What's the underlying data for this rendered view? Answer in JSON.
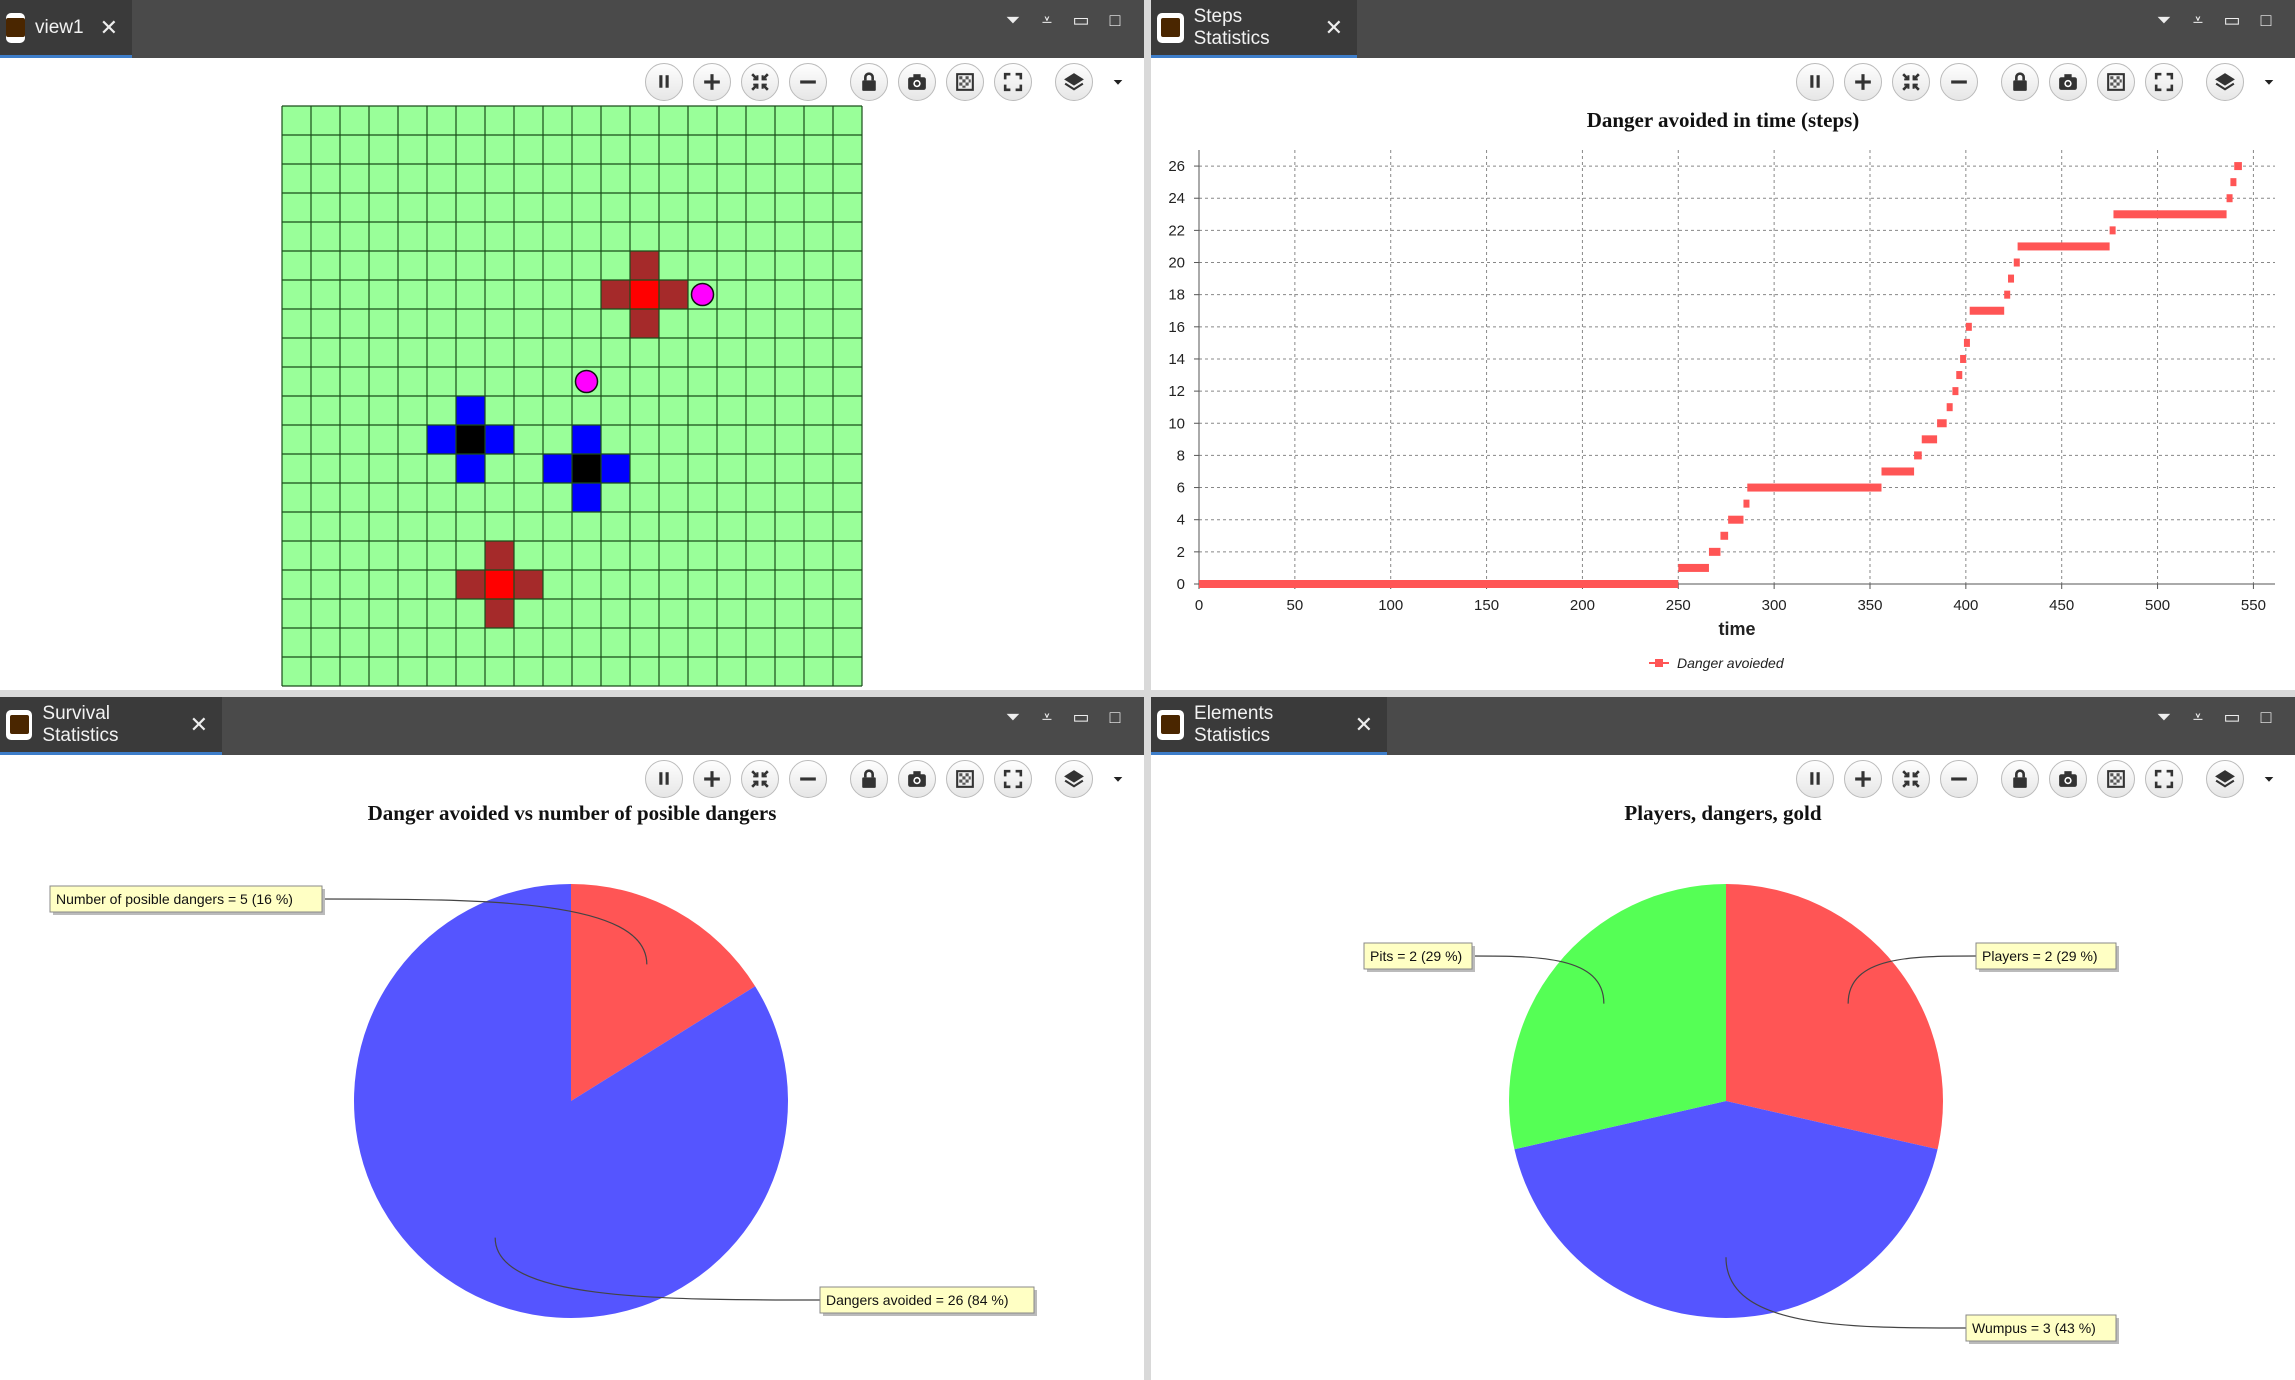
{
  "panes": {
    "view1": {
      "tab": "view1"
    },
    "steps": {
      "tab": "Steps Statistics"
    },
    "survival": {
      "tab": "Survival Statistics"
    },
    "elements": {
      "tab": "Elements Statistics"
    }
  },
  "toolbar_icons": [
    "pause-icon",
    "zoom-in-icon",
    "zoom-fit-icon",
    "zoom-out-icon",
    "lock-icon",
    "snapshot-icon",
    "toggle-overlay-icon",
    "fullscreen-icon",
    "layers-icon",
    "dropdown-arrow-icon"
  ],
  "grid": {
    "cols": 20,
    "rows": 20,
    "background": "#99ff99",
    "line_color": "#1a4d1a",
    "cells": [
      {
        "c": 12,
        "r": 5,
        "color": "#a52a2a"
      },
      {
        "c": 13,
        "r": 6,
        "color": "#a52a2a"
      },
      {
        "c": 12,
        "r": 7,
        "color": "#a52a2a"
      },
      {
        "c": 11,
        "r": 6,
        "color": "#a52a2a"
      },
      {
        "c": 12,
        "r": 6,
        "color": "#ff0000"
      },
      {
        "c": 6,
        "r": 10,
        "color": "#0000ff"
      },
      {
        "c": 7,
        "r": 11,
        "color": "#0000ff"
      },
      {
        "c": 6,
        "r": 12,
        "color": "#0000ff"
      },
      {
        "c": 5,
        "r": 11,
        "color": "#0000ff"
      },
      {
        "c": 6,
        "r": 11,
        "color": "#000000"
      },
      {
        "c": 10,
        "r": 11,
        "color": "#0000ff"
      },
      {
        "c": 11,
        "r": 12,
        "color": "#0000ff"
      },
      {
        "c": 10,
        "r": 13,
        "color": "#0000ff"
      },
      {
        "c": 9,
        "r": 12,
        "color": "#0000ff"
      },
      {
        "c": 10,
        "r": 12,
        "color": "#000000"
      },
      {
        "c": 7,
        "r": 15,
        "color": "#a52a2a"
      },
      {
        "c": 8,
        "r": 16,
        "color": "#a52a2a"
      },
      {
        "c": 7,
        "r": 17,
        "color": "#a52a2a"
      },
      {
        "c": 6,
        "r": 16,
        "color": "#a52a2a"
      },
      {
        "c": 7,
        "r": 16,
        "color": "#ff0000"
      }
    ],
    "agents": [
      {
        "c": 14,
        "r": 6,
        "color": "#ff00ff"
      },
      {
        "c": 10,
        "r": 9,
        "color": "#ff00ff"
      }
    ]
  },
  "chart_data": [
    {
      "type": "line",
      "title": "Danger avoided in time (steps)",
      "xlabel": "time",
      "ylabel": "",
      "xlim": [
        0,
        555
      ],
      "ylim": [
        0,
        27
      ],
      "x_ticks": [
        0,
        50,
        100,
        150,
        200,
        250,
        300,
        350,
        400,
        450,
        500,
        550
      ],
      "y_ticks": [
        0,
        2,
        4,
        6,
        8,
        10,
        12,
        14,
        16,
        18,
        20,
        22,
        24,
        26
      ],
      "grid": true,
      "legend_position": "bottom",
      "series": [
        {
          "name": "Danger avoieded",
          "color": "#ff5555",
          "steps": [
            [
              0,
              0
            ],
            [
              250,
              1
            ],
            [
              266,
              2
            ],
            [
              272,
              3
            ],
            [
              276,
              4
            ],
            [
              284,
              5
            ],
            [
              286,
              6
            ],
            [
              356,
              7
            ],
            [
              373,
              8
            ],
            [
              377,
              9
            ],
            [
              385,
              10
            ],
            [
              390,
              11
            ],
            [
              393,
              12
            ],
            [
              395,
              13
            ],
            [
              397,
              14
            ],
            [
              399,
              15
            ],
            [
              400,
              16
            ],
            [
              402,
              17
            ],
            [
              420,
              18
            ],
            [
              422,
              19
            ],
            [
              425,
              20
            ],
            [
              427,
              21
            ],
            [
              475,
              22
            ],
            [
              477,
              23
            ],
            [
              536,
              24
            ],
            [
              538,
              25
            ],
            [
              540,
              26
            ]
          ],
          "x_end": 544
        }
      ]
    },
    {
      "type": "pie",
      "title": "Danger avoided vs number of posible dangers",
      "slices": [
        {
          "label": "Number of posible dangers",
          "value": 5,
          "percent": 16,
          "color": "#ff5555"
        },
        {
          "label": "Dangers avoided ",
          "value": 26,
          "percent": 84,
          "color": "#5555ff"
        }
      ]
    },
    {
      "type": "pie",
      "title": "Players, dangers, gold",
      "slices": [
        {
          "label": "Players ",
          "value": 2,
          "percent": 29,
          "color": "#ff5555"
        },
        {
          "label": "Wumpus ",
          "value": 3,
          "percent": 43,
          "color": "#5555ff"
        },
        {
          "label": "Pits",
          "value": 2,
          "percent": 29,
          "color": "#55ff55"
        }
      ]
    }
  ],
  "pie_labels": {
    "survival_red": "Number of posible dangers = 5 (16 %)",
    "survival_blue": "Dangers avoided  = 26 (84 %)",
    "elements_red": "Players  = 2 (29 %)",
    "elements_blue": "Wumpus  = 3 (43 %)",
    "elements_green": "Pits = 2 (29 %)"
  }
}
